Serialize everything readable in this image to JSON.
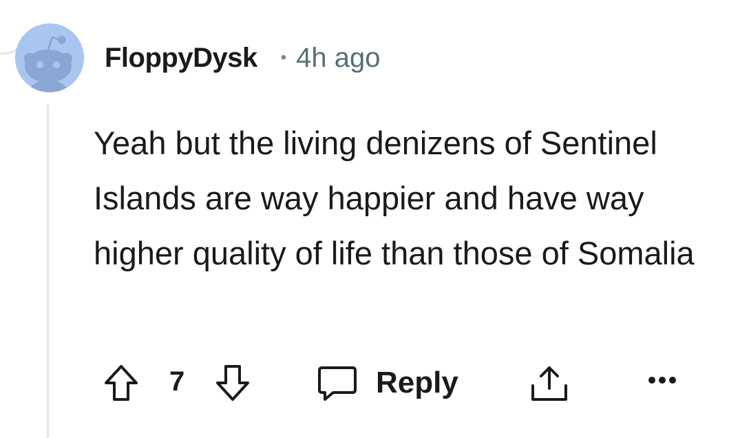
{
  "comment": {
    "username": "FloppyDysk",
    "separator": "•",
    "timestamp": "4h ago",
    "body": "Yeah but the living denizens of Sentinel Islands are way happier and have way higher quality of life than those of Somalia",
    "score": "7"
  },
  "actions": {
    "reply_label": "Reply"
  },
  "icons": {
    "avatar": "snoo-avatar-icon",
    "upvote": "upvote-arrow-icon",
    "downvote": "downvote-arrow-icon",
    "reply": "speech-bubble-icon",
    "share": "share-icon",
    "more": "more-options-icon"
  },
  "colors": {
    "text": "#1a1a1b",
    "meta": "#576f76",
    "avatar_bg": "#a8c6f0",
    "thread_line": "#e5e6e8"
  }
}
